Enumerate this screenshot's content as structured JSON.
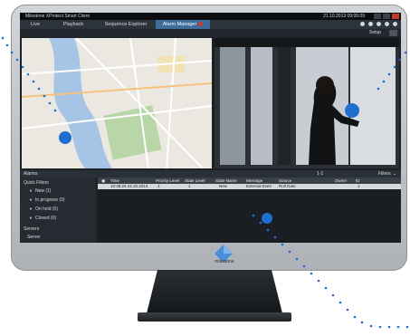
{
  "window": {
    "title": "Milestone XProtect Smart Client",
    "datetime": "21.10.2013 09:05:09"
  },
  "tabs": [
    {
      "label": "Live"
    },
    {
      "label": "Playback"
    },
    {
      "label": "Sequence Explorer"
    },
    {
      "label": "Alarm Manager",
      "active": true
    }
  ],
  "toolbar": {
    "setup_label": "Setup"
  },
  "alarms": {
    "header": "Alarms",
    "page_info": "1-1",
    "filters_label": "Filters"
  },
  "sidebar": {
    "quick_filters_label": "Quick Filters",
    "filters": [
      "New (1)",
      "In progress (0)",
      "On hold (0)",
      "Closed (0)"
    ],
    "servers_label": "Servers",
    "server_item": "Server"
  },
  "table": {
    "columns": [
      "Time",
      "Priority Level",
      "State Level",
      "State Name",
      "Message",
      "Source",
      "Owner",
      "ID"
    ],
    "rows": [
      [
        "10:48:24 24.10.2013",
        "1",
        "1",
        "New",
        "External Even",
        "Roll Gate",
        "",
        "1"
      ]
    ]
  },
  "brand": {
    "logo_text": "milestone"
  },
  "colors": {
    "accent": "#3d6c9b",
    "marker": "#1f6fd1",
    "alarm_badge": "#d23a2a"
  }
}
